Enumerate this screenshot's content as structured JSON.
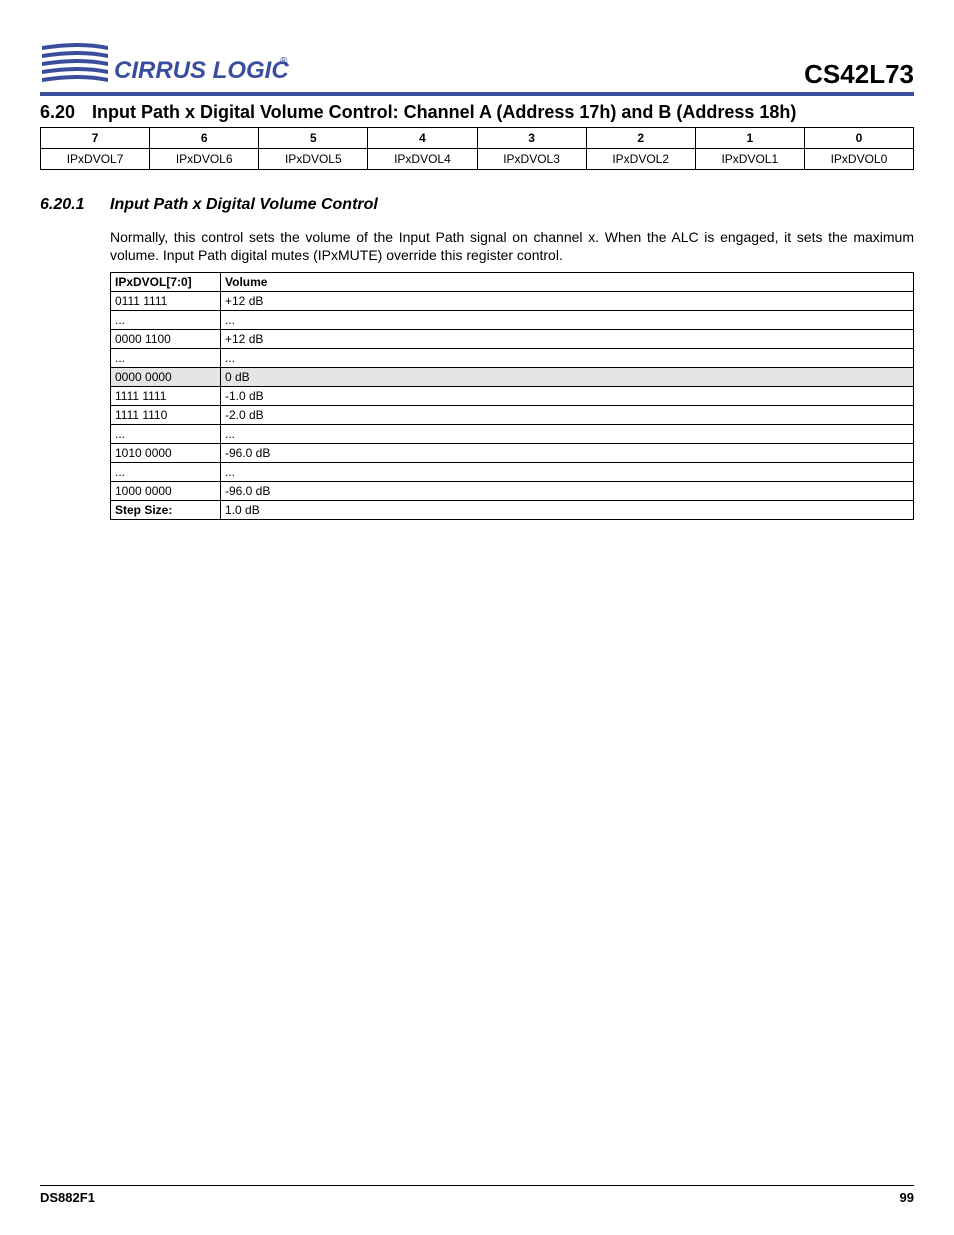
{
  "header": {
    "logo_text": "CIRRUS LOGIC",
    "logo_reg": "®",
    "part_number": "CS42L73"
  },
  "section": {
    "num": "6.20",
    "title": "Input Path x Digital Volume Control: Channel A (Address 17h) and B (Address 18h)"
  },
  "bit_table": {
    "headers": [
      "7",
      "6",
      "5",
      "4",
      "3",
      "2",
      "1",
      "0"
    ],
    "cells": [
      "IPxDVOL7",
      "IPxDVOL6",
      "IPxDVOL5",
      "IPxDVOL4",
      "IPxDVOL3",
      "IPxDVOL2",
      "IPxDVOL1",
      "IPxDVOL0"
    ]
  },
  "subsection": {
    "num": "6.20.1",
    "title": "Input Path x Digital Volume Control",
    "paragraph": "Normally, this control sets the volume of the Input Path signal on channel x. When the ALC is engaged, it sets the maximum volume. Input Path digital mutes (IPxMUTE) override this register control."
  },
  "vol_table": {
    "header": [
      "IPxDVOL[7:0]",
      "Volume"
    ],
    "rows": [
      {
        "c0": "0111 1111",
        "c1": "+12 dB",
        "shade": false
      },
      {
        "c0": "...",
        "c1": "...",
        "shade": false
      },
      {
        "c0": "0000 1100",
        "c1": "+12 dB",
        "shade": false
      },
      {
        "c0": "...",
        "c1": "...",
        "shade": false
      },
      {
        "c0": "0000 0000",
        "c1": "0 dB",
        "shade": true
      },
      {
        "c0": "1111 1111",
        "c1": "-1.0 dB",
        "shade": false
      },
      {
        "c0": "1111 1110",
        "c1": "-2.0 dB",
        "shade": false
      },
      {
        "c0": "...",
        "c1": "...",
        "shade": false
      },
      {
        "c0": "1010 0000",
        "c1": "-96.0 dB",
        "shade": false
      },
      {
        "c0": "...",
        "c1": "...",
        "shade": false
      },
      {
        "c0": "1000 0000",
        "c1": "-96.0 dB",
        "shade": false
      }
    ],
    "step_label": "Step Size:",
    "step_value": "1.0 dB"
  },
  "footer": {
    "doc_id": "DS882F1",
    "page": "99"
  }
}
